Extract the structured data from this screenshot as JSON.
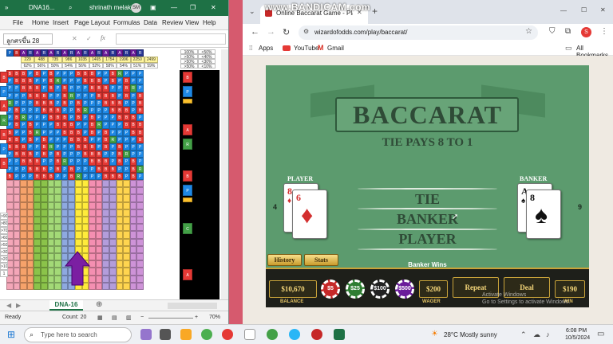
{
  "excel": {
    "title": "DNA16...",
    "user": "shrinath melakeri",
    "user_initials": "SM",
    "menu": [
      "File",
      "Home",
      "Insert",
      "Page Layout",
      "Formulas",
      "Data",
      "Review",
      "View",
      "Help"
    ],
    "name_box": "ลูกศรขึ้น 28",
    "sheet_tab": "DNA-16",
    "status_ready": "Ready",
    "status_count": "Count: 20",
    "zoom": "70%",
    "percent_labels": [
      "100%",
      ">50%",
      ">50%",
      ">50%"
    ],
    "percent_values": [
      "<50%",
      "<40%",
      "<30%",
      "<10%"
    ],
    "header_row": [
      "P",
      "B",
      "A",
      "R",
      "A",
      "R",
      "A",
      "R",
      "A",
      "R",
      "A",
      "R",
      "A",
      "R",
      "A",
      "R",
      "A",
      "R",
      "A",
      "R"
    ],
    "count_row_1": [
      "229",
      "488",
      "735",
      "986",
      "1035",
      "1465",
      "1754",
      "1996",
      "2250",
      "2499"
    ],
    "count_row_2": [
      "62%",
      "56%",
      "50%",
      "54%",
      "56%",
      "52%",
      "58%",
      "54%",
      "51%",
      "59%"
    ],
    "row_labels": [
      ">90",
      ">80",
      ">70",
      ">60",
      ">50",
      ">30",
      ">20",
      ">10",
      "1"
    ],
    "side_tags": [
      "B",
      "P",
      "A",
      "R",
      "B",
      "P",
      "B"
    ]
  },
  "browser": {
    "tab_title": "Online Baccarat Game - Pla",
    "url": "wizardofodds.com/play/baccarat/",
    "bookmarks": [
      "Apps",
      "YouTube",
      "Gmail"
    ],
    "all_bookmarks": "All Bookmarks",
    "profile_initial": "S"
  },
  "game": {
    "title": "BACCARAT",
    "subtitle": "TIE PAYS 8 TO 1",
    "player_label": "PLAYER",
    "banker_label": "BANKER",
    "player_score": "4",
    "banker_score": "9",
    "player_cards": [
      {
        "rank": "8",
        "suit": "♦"
      },
      {
        "rank": "6",
        "suit": "♦"
      }
    ],
    "banker_cards": [
      {
        "rank": "A",
        "suit": "♠"
      },
      {
        "rank": "8",
        "suit": "♠"
      }
    ],
    "bets": [
      "TIE",
      "BANKER",
      "PLAYER"
    ],
    "result": "Banker Wins",
    "history_label": "History",
    "stats_label": "Stats",
    "balance": "$10,670",
    "balance_label": "BALANCE",
    "chips": [
      {
        "label": "$5",
        "color": "#c62828"
      },
      {
        "label": "$25",
        "color": "#2e7d32"
      },
      {
        "label": "$100",
        "color": "#222222"
      },
      {
        "label": "$500",
        "color": "#6a1b9a"
      }
    ],
    "wager": "$200",
    "wager_label": "WAGER",
    "repeat_label": "Repeat",
    "deal_label": "Deal",
    "win": "$190",
    "win_label": "WIN"
  },
  "overlays": {
    "bandicam": "www.BANDICAM.com",
    "activate_line1": "Activate Windows",
    "activate_line2": "Go to Settings to activate Windows."
  },
  "taskbar": {
    "search_placeholder": "Type here to search",
    "weather": "28°C  Mostly sunny",
    "time": "6:08 PM",
    "date": "10/5/2024"
  },
  "colors": {
    "excel_green": "#1e7145",
    "felt": "#5c9b6e",
    "gold": "#c9a33a"
  }
}
